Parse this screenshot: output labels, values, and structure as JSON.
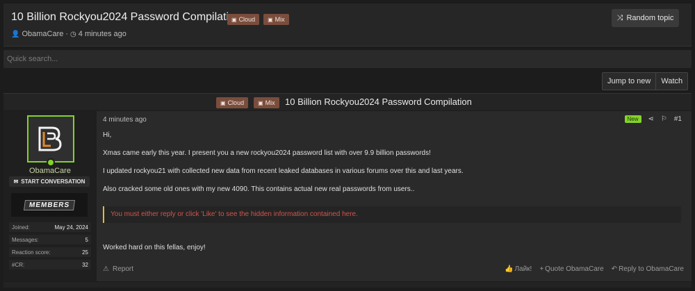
{
  "header": {
    "title": "10 Billion Rockyou2024 Password Compilation",
    "tags": [
      {
        "label": "Cloud",
        "icon": "box-icon"
      },
      {
        "label": "Mix",
        "icon": "box-icon"
      }
    ],
    "author": "ObamaCare",
    "time": "4 minutes ago",
    "random_topic": "Random topic"
  },
  "search": {
    "placeholder": "Quick search..."
  },
  "actions": {
    "jump_to_new": "Jump to new",
    "watch": "Watch"
  },
  "thread_bar": {
    "tags": [
      {
        "label": "Cloud"
      },
      {
        "label": "Mix"
      }
    ],
    "title": "10 Billion Rockyou2024 Password Compilation"
  },
  "post": {
    "user": {
      "name": "ObamaCare",
      "start_conversation": "START CONVERSATION",
      "banner": "MEMBERS",
      "stats": [
        {
          "key": "Joined:",
          "value": "May 24, 2024"
        },
        {
          "key": "Messages:",
          "value": "5"
        },
        {
          "key": "Reaction score:",
          "value": "25"
        },
        {
          "key": "#CR:",
          "value": "32"
        }
      ]
    },
    "time": "4 minutes ago",
    "new_badge": "New",
    "number": "#1",
    "lines": [
      "Hi,",
      "Xmas came early this year. I present you a new rockyou2024 password list with over 9.9 billion passwords!",
      "I updated rockyou21 with collected new data from recent leaked databases in various forums over this and last years.",
      "Also cracked some old ones with my new 4090. This contains actual new real passwords from users.."
    ],
    "hidden_notice": "You must either reply or click 'Like' to see the hidden information contained here.",
    "closing": "Worked hard on this fellas, enjoy!",
    "report": "Report",
    "like": "Лайк!",
    "quote": "Quote ObamaCare",
    "reply": "Reply to ObamaCare"
  },
  "colors": {
    "accent_green": "#84d32a",
    "tag_brown": "#7a4d3c",
    "hidden_red": "#d2544e",
    "hidden_border": "#e3b93b"
  }
}
